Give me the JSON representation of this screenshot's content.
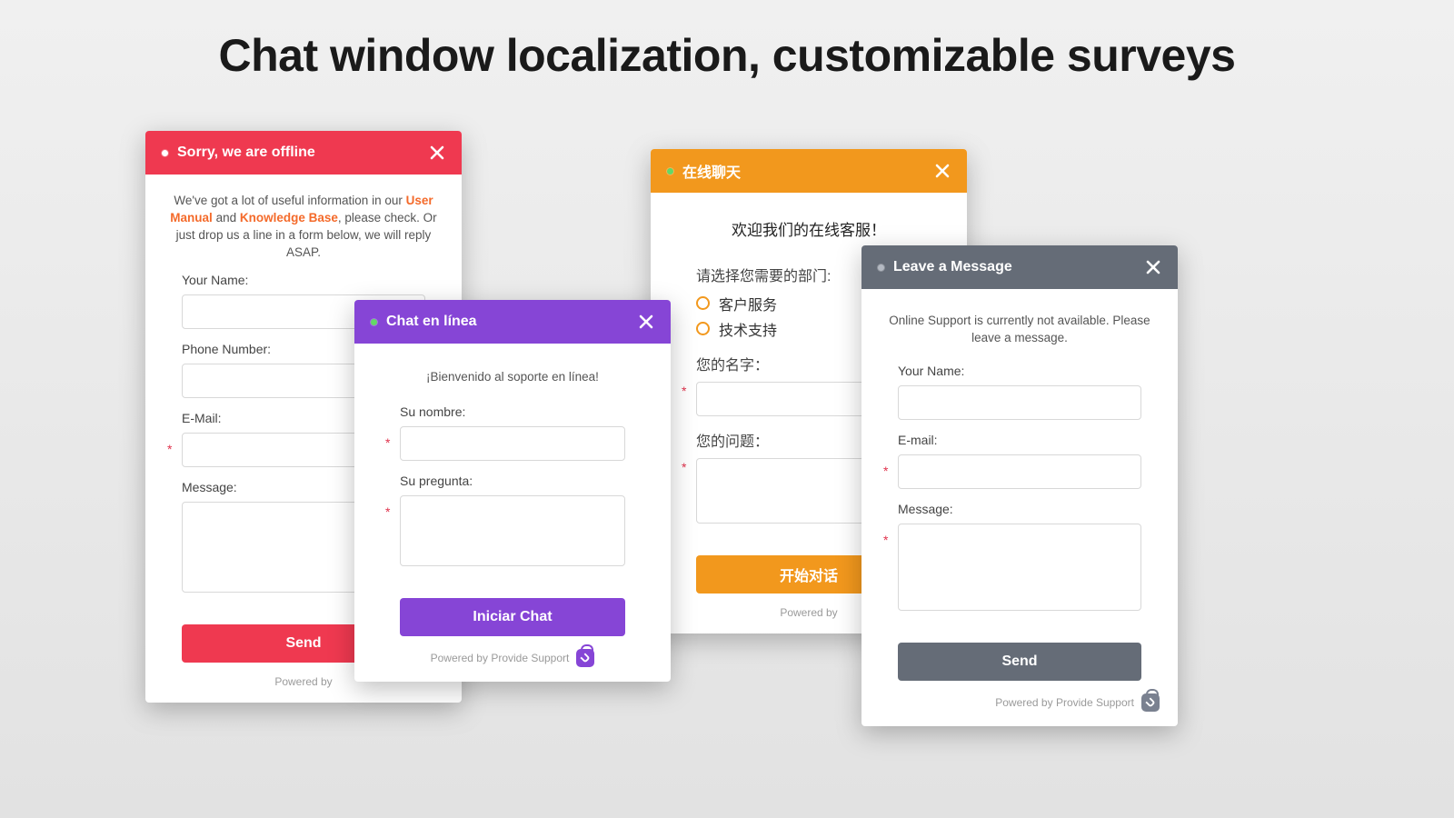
{
  "page": {
    "title": "Chat window localization, customizable surveys"
  },
  "powered_by": "Powered by Provide Support",
  "widget1": {
    "header_title": "Sorry, we are offline",
    "intro_pre": "We've got a lot of useful information in our ",
    "link1": "User Manual",
    "intro_mid": " and ",
    "link2": "Knowledge Base",
    "intro_post": ", please check. Or just drop us a line in a form below, we will reply ASAP.",
    "label_name": "Your Name:",
    "label_phone": "Phone Number:",
    "label_email": "E-Mail:",
    "label_message": "Message:",
    "button": "Send",
    "powered": "Powered by"
  },
  "widget2": {
    "header_title": "Chat en línea",
    "intro": "¡Bienvenido al soporte en línea!",
    "label_name": "Su nombre:",
    "label_question": "Su pregunta:",
    "button": "Iniciar Chat"
  },
  "widget3": {
    "header_title": "在线聊天",
    "intro": "欢迎我们的在线客服！",
    "dept_prompt": "请选择您需要的部门:",
    "dept1": "客户服务",
    "dept2": "技术支持",
    "label_name": "您的名字：",
    "label_question": "您的问题：",
    "button": "开始对话",
    "powered": "Powered by"
  },
  "widget4": {
    "header_title": "Leave a Message",
    "intro": "Online Support is currently not available. Please leave a message.",
    "label_name": "Your Name:",
    "label_email": "E-mail:",
    "label_message": "Message:",
    "button": "Send"
  },
  "required_mark": "*"
}
